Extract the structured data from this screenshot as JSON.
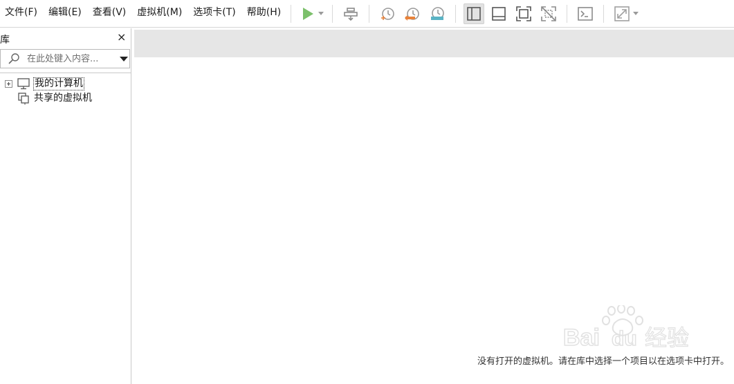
{
  "menu": {
    "file": "文件(F)",
    "edit": "编辑(E)",
    "view": "查看(V)",
    "vm": "虚拟机(M)",
    "tabs": "选项卡(T)",
    "help": "帮助(H)"
  },
  "toolbar": {
    "icons": [
      "play-icon",
      "send-keys-icon",
      "snapshot-take-icon",
      "snapshot-revert-icon",
      "snapshot-manager-icon",
      "show-library-icon",
      "show-thumbnail-bar-icon",
      "fullscreen-icon",
      "unity-icon",
      "console-icon",
      "stretch-icon"
    ],
    "active": "show-library-icon",
    "colors": {
      "play": "#7cc06b",
      "revert": "#e8823a",
      "manager": "#5ab3c4",
      "icon_gray": "#8a8a8a"
    }
  },
  "library": {
    "title": "库",
    "close": "×",
    "search_placeholder": "在此处键入内容...",
    "items": [
      {
        "label": "我的计算机",
        "icon": "computer-icon",
        "expandable": true,
        "selected": true
      },
      {
        "label": "共享的虚拟机",
        "icon": "shared-vms-icon",
        "expandable": false,
        "selected": false
      }
    ]
  },
  "main": {
    "hint": "没有打开的虚拟机。请在库中选择一个项目以在选项卡中打开。"
  },
  "watermark": {
    "text": "Baidu经验"
  }
}
